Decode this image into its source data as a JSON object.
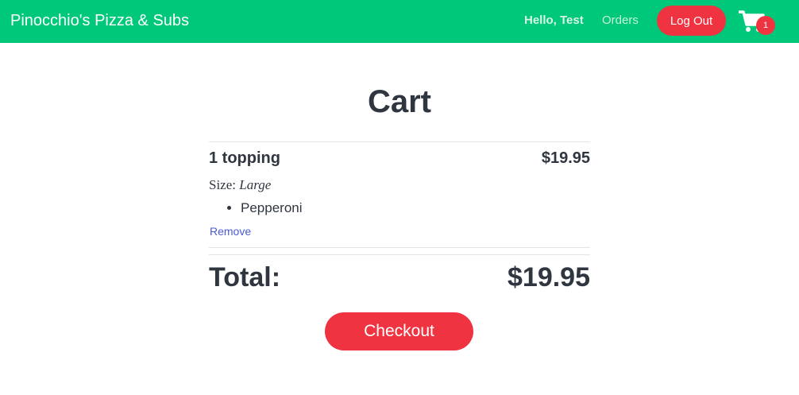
{
  "header": {
    "brand": "Pinocchio's Pizza & Subs",
    "greeting": "Hello, Test",
    "orders_label": "Orders",
    "logout_label": "Log Out",
    "cart_icon": "shopping-cart-icon",
    "cart_count": "1"
  },
  "cart": {
    "title": "Cart",
    "items": [
      {
        "name": "1 topping",
        "price": "$19.95",
        "size_label": "Size:",
        "size_value": "Large",
        "toppings": [
          "Pepperoni"
        ],
        "remove_label": "Remove"
      }
    ],
    "total_label": "Total:",
    "total_value": "$19.95",
    "checkout_label": "Checkout"
  },
  "colors": {
    "navbar": "#00c87a",
    "accent_red": "#ef3340",
    "text_dark": "#2f3640",
    "link_blue": "#4a5bd4"
  }
}
